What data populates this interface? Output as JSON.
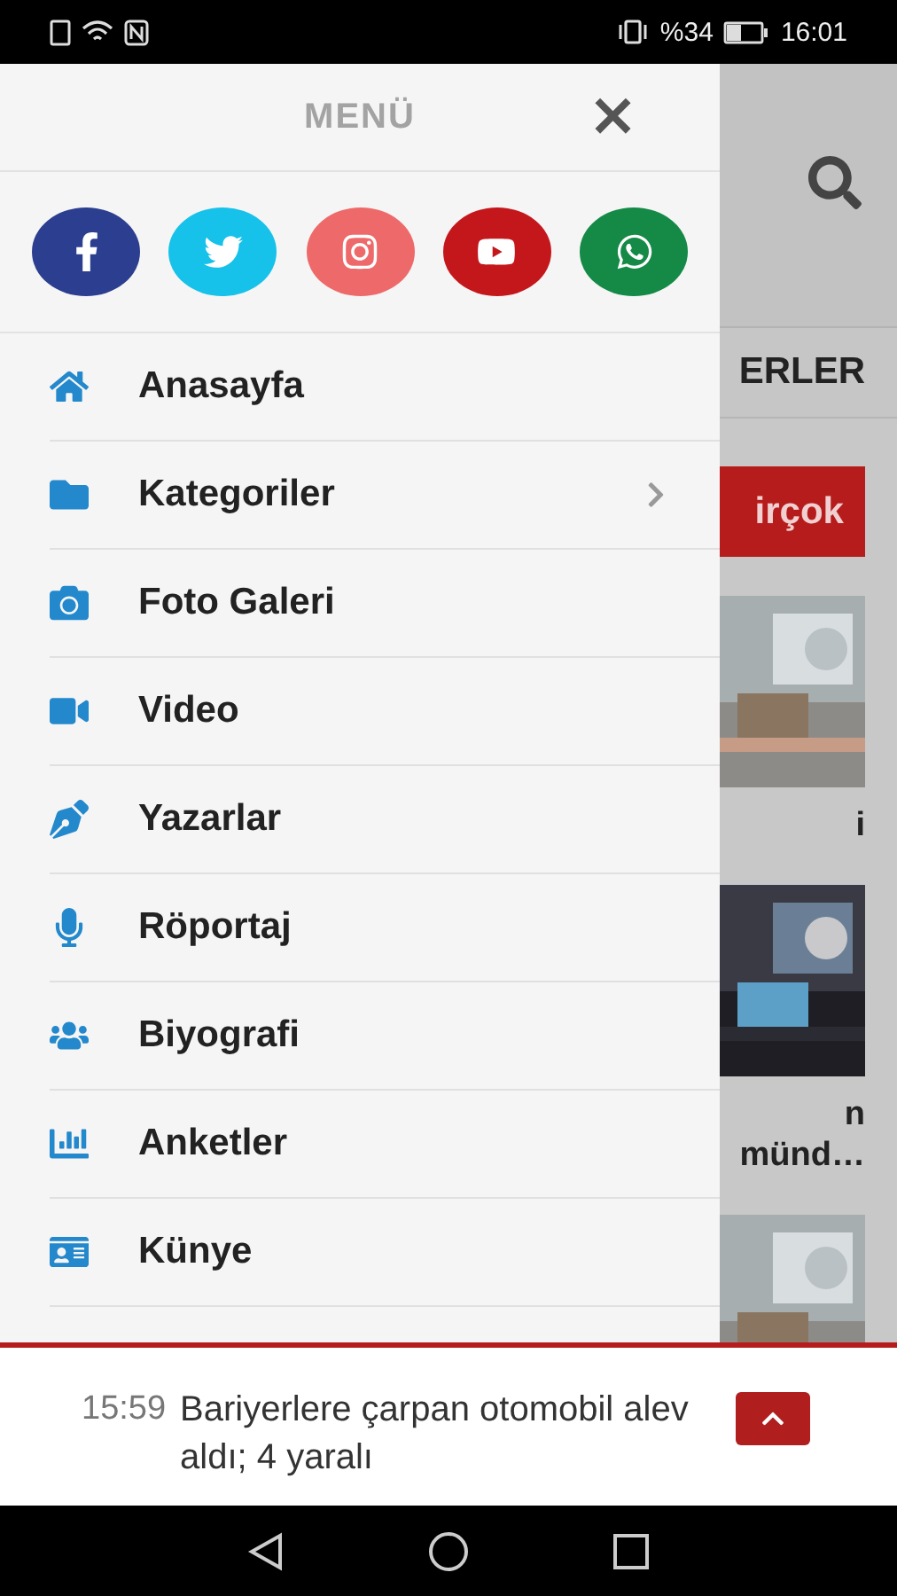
{
  "status_bar": {
    "battery": "%34",
    "time": "16:01"
  },
  "background_page": {
    "tab": "ERLER",
    "badge": "irçok",
    "feed": [
      {
        "kind": "picture"
      },
      {
        "kind": "caption",
        "lines": [
          "i"
        ]
      },
      {
        "kind": "picture"
      },
      {
        "kind": "caption",
        "lines": [
          "n",
          "münd…"
        ]
      },
      {
        "kind": "picture"
      }
    ]
  },
  "drawer": {
    "title": "MENÜ",
    "close": "×",
    "social": [
      {
        "color": "#2c3e8f"
      },
      {
        "color": "#16c1ea"
      },
      {
        "color": "#ee6a6a"
      },
      {
        "color": "#c4171c"
      },
      {
        "color": "#148a46"
      }
    ],
    "items": [
      {
        "label": "Anasayfa",
        "has_submenu": false
      },
      {
        "label": "Kategoriler",
        "has_submenu": true
      },
      {
        "label": "Foto Galeri",
        "has_submenu": false
      },
      {
        "label": "Video",
        "has_submenu": false
      },
      {
        "label": "Yazarlar",
        "has_submenu": false
      },
      {
        "label": "Röportaj",
        "has_submenu": false
      },
      {
        "label": "Biyografi",
        "has_submenu": false
      },
      {
        "label": "Anketler",
        "has_submenu": false
      },
      {
        "label": "Künye",
        "has_submenu": false
      }
    ]
  },
  "breaking_news": {
    "time": "15:59",
    "headline": "Bariyerlere çarpan otomobil alev aldı; 4 yaralı"
  }
}
